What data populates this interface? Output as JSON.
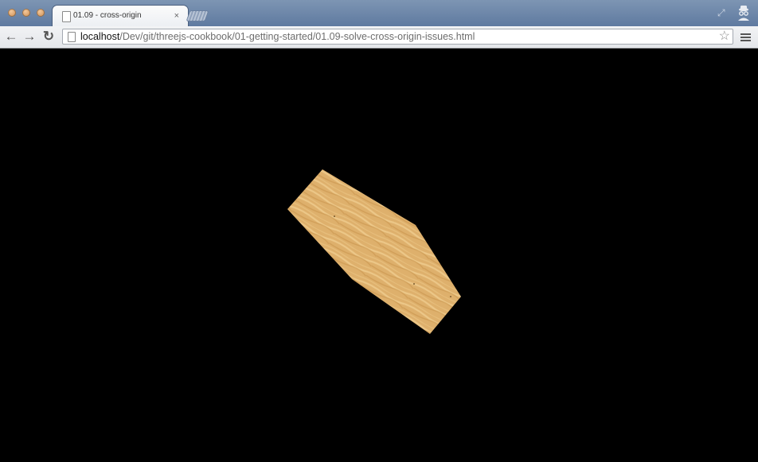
{
  "tab": {
    "title": "01.09 - cross-origin",
    "close_glyph": "×"
  },
  "toolbar": {
    "back_glyph": "←",
    "forward_glyph": "→",
    "reload_glyph": "↻",
    "url_host": "localhost",
    "url_path": "/Dev/git/threejs-cookbook/01-getting-started/01.09-solve-cross-origin-issues.html",
    "star_glyph": "☆"
  },
  "icons": {
    "tab_page": "page-icon",
    "fullscreen": "fullscreen-icon",
    "incognito": "incognito-icon",
    "menu": "hamburger-menu-icon"
  },
  "colors": {
    "tabstrip": "#6f88aa",
    "canvas_background": "#000000",
    "texture_base": "#deb06c",
    "texture_light": "#efcb8d",
    "texture_dark": "#c9964f"
  }
}
